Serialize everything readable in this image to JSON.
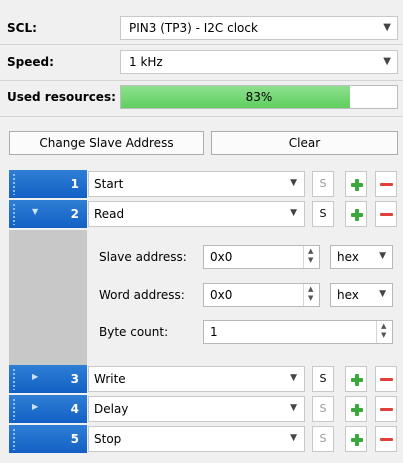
{
  "config": {
    "scl": {
      "label": "SCL:",
      "value": "PIN3 (TP3) - I2C clock"
    },
    "speed": {
      "label": "Speed:",
      "value": "1 kHz"
    },
    "resources": {
      "label": "Used resources:",
      "percent_text": "83%",
      "fraction": 0.83
    }
  },
  "actions": {
    "change_slave": "Change Slave Address",
    "clear": "Clear"
  },
  "sequence": [
    {
      "index": "1",
      "op": "Start",
      "s_label": "S",
      "expanded": false
    },
    {
      "index": "2",
      "op": "Read",
      "s_label": "S",
      "expanded": true
    },
    {
      "index": "3",
      "op": "Write",
      "s_label": "S",
      "expanded": false
    },
    {
      "index": "4",
      "op": "Delay",
      "s_label": "S",
      "expanded": false
    },
    {
      "index": "5",
      "op": "Stop",
      "s_label": "S",
      "expanded": false
    }
  ],
  "read_details": {
    "slave_address": {
      "label": "Slave address:",
      "value": "0x0",
      "format": "hex"
    },
    "word_address": {
      "label": "Word address:",
      "value": "0x0",
      "format": "hex"
    },
    "byte_count": {
      "label": "Byte count:",
      "value": "1"
    }
  },
  "colors": {
    "accent": "#1a6ad0",
    "progress": "#6cd46c",
    "add": "#3aa83a",
    "remove": "#e0403a"
  }
}
